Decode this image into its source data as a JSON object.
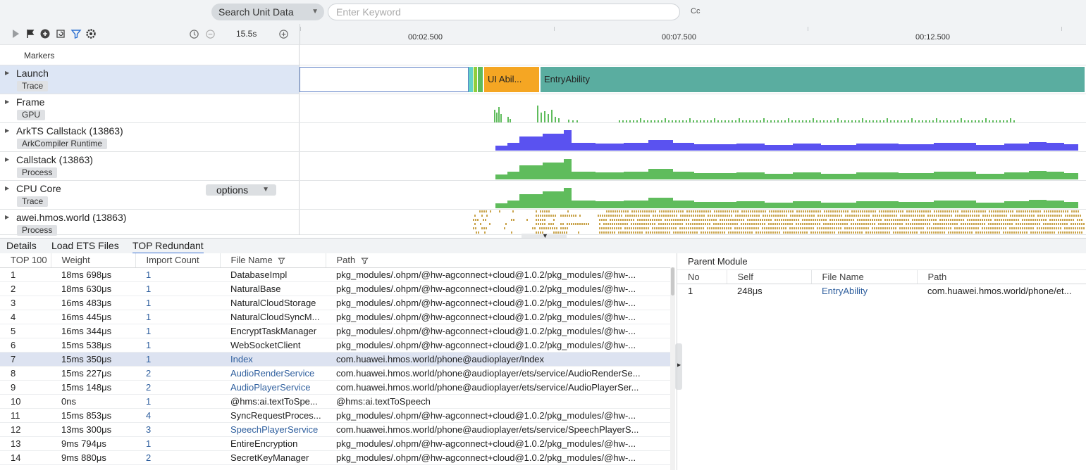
{
  "search": {
    "scope_label": "Search Unit Data",
    "keyword_placeholder": "Enter Keyword",
    "case_toggle": "Cc"
  },
  "toolbar": {
    "zoom_label": "15.5s",
    "icons": [
      "play-icon",
      "flag-icon",
      "add-circle-icon",
      "refresh-icon",
      "filter-icon",
      "settings-icon",
      "clock-icon",
      "zoom-out-icon",
      "zoom-in-icon"
    ]
  },
  "timeline": {
    "ticks": [
      "00:02.500",
      "00:07.500",
      "00:12.500"
    ]
  },
  "markers": {
    "label": "Markers"
  },
  "lanes": [
    {
      "title": "Launch",
      "tag": "Trace"
    },
    {
      "title": "Frame",
      "tag": "GPU"
    },
    {
      "title": "ArkTS Callstack (13863)",
      "tag": "ArkCompiler Runtime"
    },
    {
      "title": "Callstack (13863)",
      "tag": "Process"
    },
    {
      "title": "CPU Core",
      "tag": "Trace",
      "dropdown": "options"
    },
    {
      "title": "awei.hmos.world (13863)",
      "tag": "Process"
    }
  ],
  "launch_slices": [
    {
      "label": "UI Abil...",
      "color": "#f5a623"
    },
    {
      "label": "EntryAbility",
      "color": "#5aada0"
    }
  ],
  "colors": {
    "arkts": "#5a52f0",
    "callstack": "#5fbc5c",
    "process": "#c9a34a",
    "frame": "#5fbc5c"
  },
  "tabs": [
    "Details",
    "Load ETS Files",
    "TOP Redundant"
  ],
  "main_table": {
    "headers": [
      "TOP 100",
      "Weight",
      "Import Count",
      "File Name",
      "Path"
    ],
    "rows": [
      [
        "1",
        "18ms 698μs",
        "1",
        "DatabaseImpl",
        "pkg_modules/.ohpm/@hw-agconnect+cloud@1.0.2/pkg_modules/@hw-..."
      ],
      [
        "2",
        "18ms 630μs",
        "1",
        "NaturalBase",
        "pkg_modules/.ohpm/@hw-agconnect+cloud@1.0.2/pkg_modules/@hw-..."
      ],
      [
        "3",
        "16ms 483μs",
        "1",
        "NaturalCloudStorage",
        "pkg_modules/.ohpm/@hw-agconnect+cloud@1.0.2/pkg_modules/@hw-..."
      ],
      [
        "4",
        "16ms 445μs",
        "1",
        "NaturalCloudSyncM...",
        "pkg_modules/.ohpm/@hw-agconnect+cloud@1.0.2/pkg_modules/@hw-..."
      ],
      [
        "5",
        "16ms 344μs",
        "1",
        "EncryptTaskManager",
        "pkg_modules/.ohpm/@hw-agconnect+cloud@1.0.2/pkg_modules/@hw-..."
      ],
      [
        "6",
        "15ms 538μs",
        "1",
        "WebSocketClient",
        "pkg_modules/.ohpm/@hw-agconnect+cloud@1.0.2/pkg_modules/@hw-..."
      ],
      [
        "7",
        "15ms 350μs",
        "1",
        "Index",
        "com.huawei.hmos.world/phone@audioplayer/Index"
      ],
      [
        "8",
        "15ms 227μs",
        "2",
        "AudioRenderService",
        "com.huawei.hmos.world/phone@audioplayer/ets/service/AudioRenderSe..."
      ],
      [
        "9",
        "15ms 148μs",
        "2",
        "AudioPlayerService",
        "com.huawei.hmos.world/phone@audioplayer/ets/service/AudioPlayerSer..."
      ],
      [
        "10",
        "0ns",
        "1",
        "@hms:ai.textToSpe...",
        "@hms:ai.textToSpeech"
      ],
      [
        "11",
        "15ms 853μs",
        "4",
        "SyncRequestProces...",
        "pkg_modules/.ohpm/@hw-agconnect+cloud@1.0.2/pkg_modules/@hw-..."
      ],
      [
        "12",
        "13ms 300μs",
        "3",
        "SpeechPlayerService",
        "com.huawei.hmos.world/phone@audioplayer/ets/service/SpeechPlayerS..."
      ],
      [
        "13",
        "9ms 794μs",
        "1",
        "EntireEncryption",
        "pkg_modules/.ohpm/@hw-agconnect+cloud@1.0.2/pkg_modules/@hw-..."
      ],
      [
        "14",
        "9ms 880μs",
        "2",
        "SecretKeyManager",
        "pkg_modules/.ohpm/@hw-agconnect+cloud@1.0.2/pkg_modules/@hw-..."
      ]
    ],
    "link_rows": [
      7,
      8,
      9,
      12
    ],
    "selected_row": 7
  },
  "parent_module": {
    "title": "Parent Module",
    "headers": [
      "No",
      "Self",
      "File Name",
      "Path"
    ],
    "rows": [
      [
        "1",
        "248μs",
        "EntryAbility",
        "com.huawei.hmos.world/phone/et..."
      ]
    ]
  }
}
